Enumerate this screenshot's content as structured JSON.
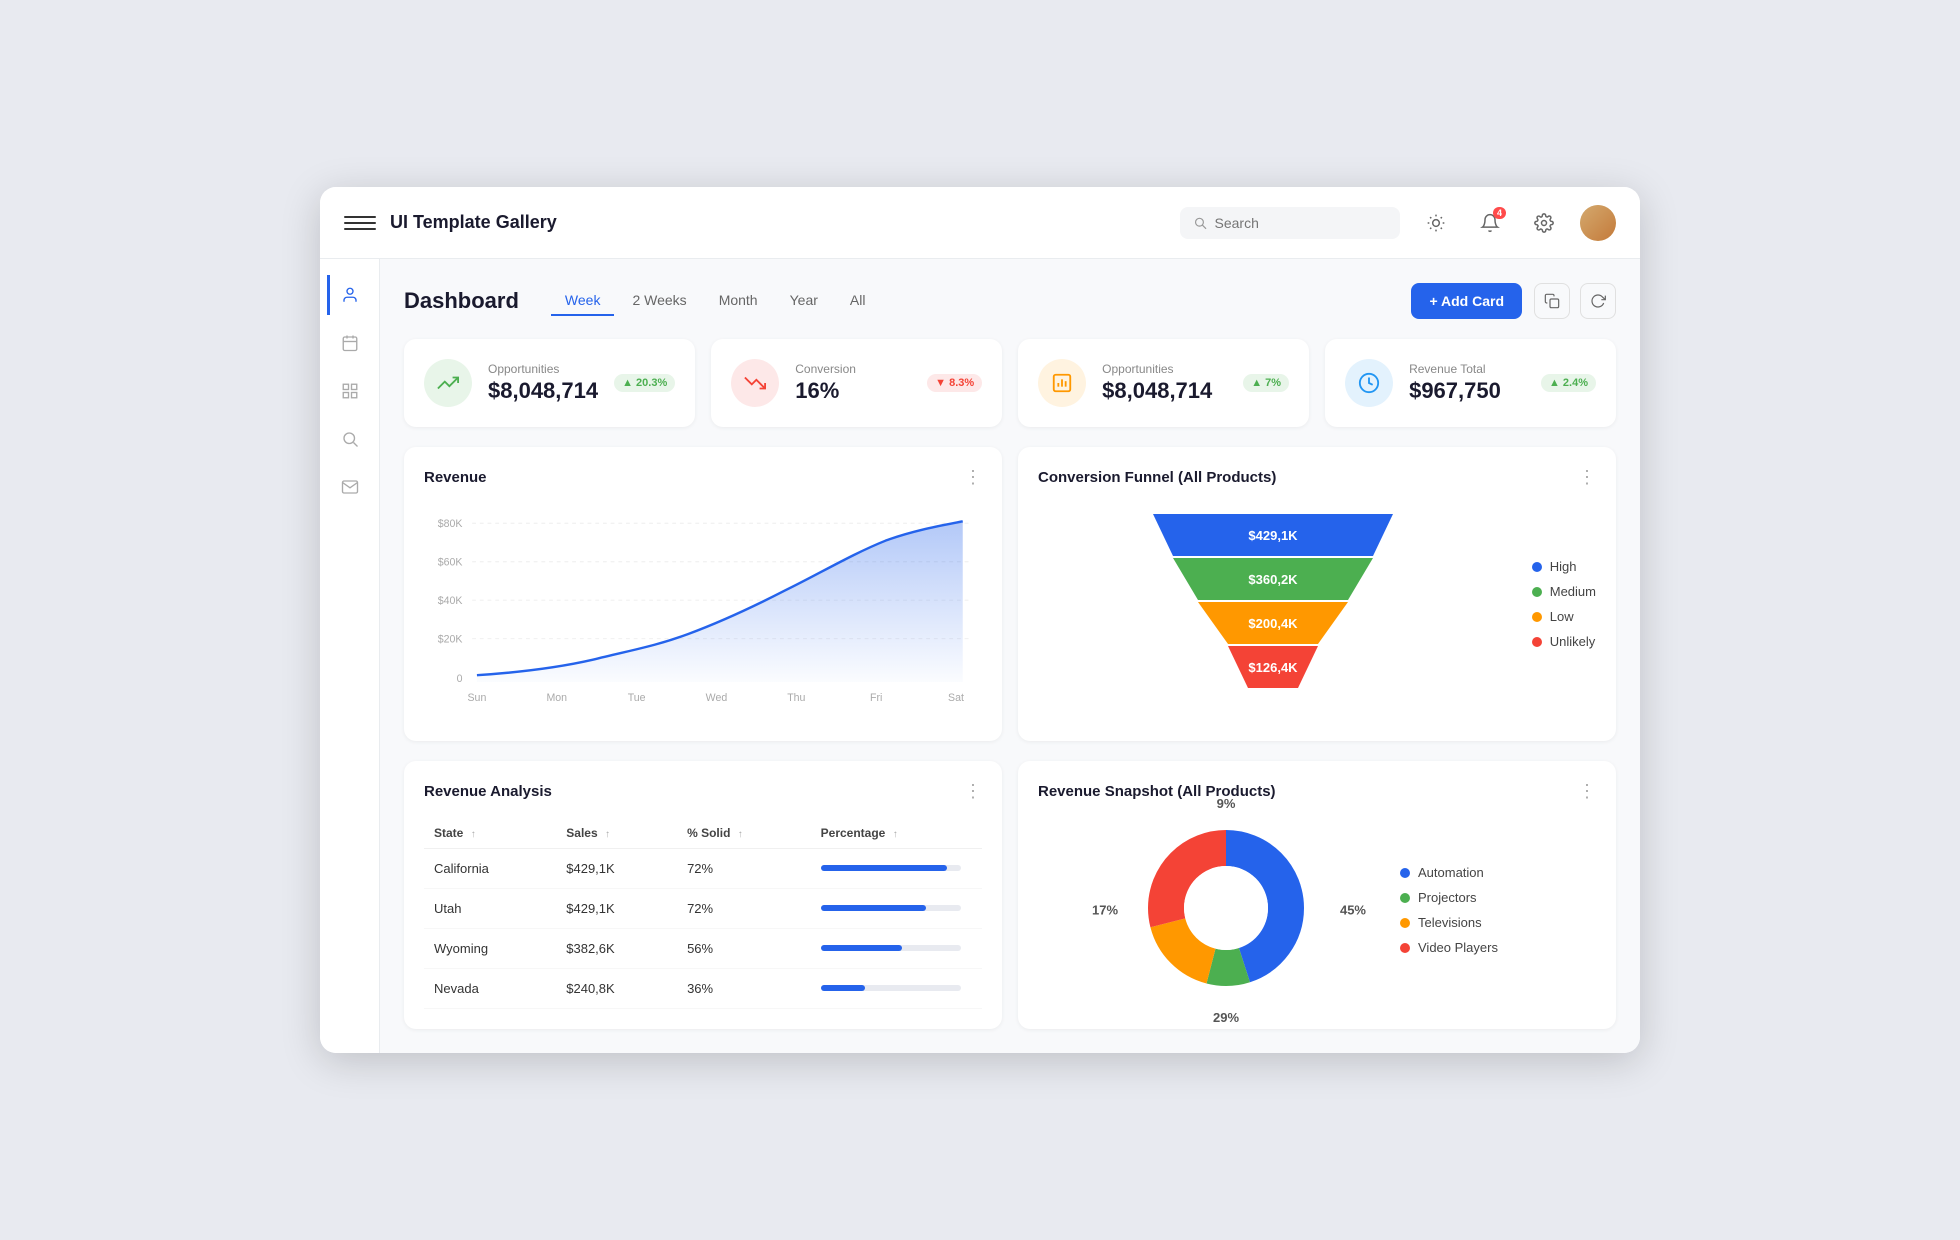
{
  "app": {
    "title": "UI Template Gallery"
  },
  "topnav": {
    "search_placeholder": "Search",
    "notification_count": "4"
  },
  "sidebar": {
    "items": [
      {
        "id": "user",
        "icon": "👤",
        "active": true
      },
      {
        "id": "calendar",
        "icon": "📅",
        "active": false
      },
      {
        "id": "table",
        "icon": "▦",
        "active": false
      },
      {
        "id": "search",
        "icon": "🔍",
        "active": false
      },
      {
        "id": "mail",
        "icon": "✉",
        "active": false
      }
    ]
  },
  "dashboard": {
    "title": "Dashboard",
    "tabs": [
      "Week",
      "2 Weeks",
      "Month",
      "Year",
      "All"
    ],
    "active_tab": "Week",
    "add_card_label": "+ Add Card"
  },
  "kpi_cards": [
    {
      "label": "Opportunities",
      "value": "$8,048,714",
      "badge": "20.3%",
      "direction": "up",
      "icon_type": "green"
    },
    {
      "label": "Conversion",
      "value": "16%",
      "badge": "8.3%",
      "direction": "down",
      "icon_type": "red"
    },
    {
      "label": "Opportunities",
      "value": "$8,048,714",
      "badge": "7%",
      "direction": "up",
      "icon_type": "orange"
    },
    {
      "label": "Revenue Total",
      "value": "$967,750",
      "badge": "2.4%",
      "direction": "up",
      "icon_type": "blue"
    }
  ],
  "revenue_chart": {
    "title": "Revenue",
    "y_labels": [
      "$80K",
      "$60K",
      "$40K",
      "$20K",
      "0"
    ],
    "x_labels": [
      "Sun",
      "Mon",
      "Tue",
      "Wed",
      "Thu",
      "Fri",
      "Sat"
    ]
  },
  "funnel_chart": {
    "title": "Conversion Funnel (All Products)",
    "segments": [
      {
        "label": "$429,1K",
        "color": "#2563eb",
        "width_pct": 100
      },
      {
        "label": "$360,2K",
        "color": "#4caf50",
        "width_pct": 80
      },
      {
        "label": "$200,4K",
        "color": "#ff9800",
        "width_pct": 60
      },
      {
        "label": "$126,4K",
        "color": "#f44336",
        "width_pct": 40
      }
    ],
    "legend": [
      {
        "label": "High",
        "color": "#2563eb"
      },
      {
        "label": "Medium",
        "color": "#4caf50"
      },
      {
        "label": "Low",
        "color": "#ff9800"
      },
      {
        "label": "Unlikely",
        "color": "#f44336"
      }
    ]
  },
  "revenue_analysis": {
    "title": "Revenue Analysis",
    "columns": [
      "State",
      "Sales",
      "% Solid",
      "Percentage"
    ],
    "rows": [
      {
        "state": "California",
        "sales": "$429,1K",
        "solid": "72%",
        "pct": 90
      },
      {
        "state": "Utah",
        "sales": "$429,1K",
        "solid": "72%",
        "pct": 75
      },
      {
        "state": "Wyoming",
        "sales": "$382,6K",
        "solid": "56%",
        "pct": 58
      },
      {
        "state": "Nevada",
        "sales": "$240,8K",
        "solid": "36%",
        "pct": 32
      }
    ]
  },
  "revenue_snapshot": {
    "title": "Revenue Snapshot (All Products)",
    "segments": [
      {
        "label": "Automation",
        "color": "#2563eb",
        "pct": 45
      },
      {
        "label": "Projectors",
        "color": "#4caf50",
        "pct": 9
      },
      {
        "label": "Televisions",
        "color": "#ff9800",
        "pct": 17
      },
      {
        "label": "Video Players",
        "color": "#f44336",
        "pct": 29
      }
    ],
    "pct_labels": [
      {
        "value": "45%",
        "pos": "right"
      },
      {
        "value": "9%",
        "pos": "top"
      },
      {
        "value": "17%",
        "pos": "left"
      },
      {
        "value": "29%",
        "pos": "bottom"
      }
    ]
  }
}
